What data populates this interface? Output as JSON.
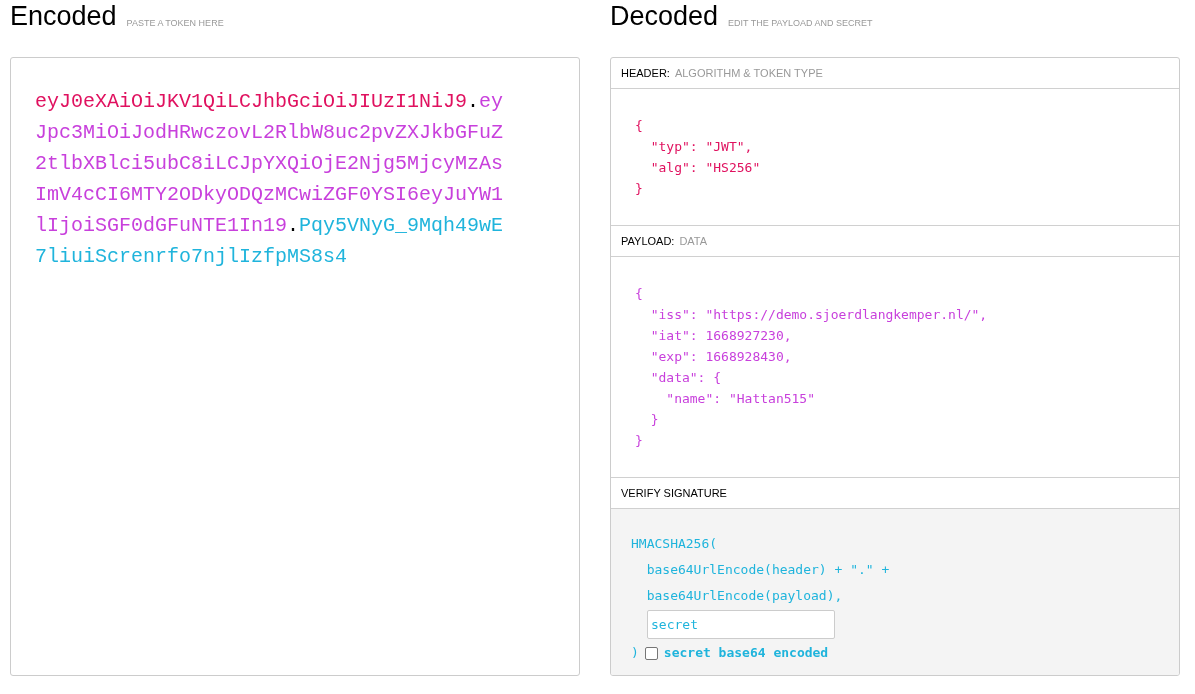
{
  "encoded": {
    "title": "Encoded",
    "hint": "PASTE A TOKEN HERE",
    "parts": [
      {
        "text": "eyJ0eXAiOiJKV1QiLCJhbGciOiJIUzI1NiJ9",
        "color": "#e0115f"
      },
      {
        "text": ".",
        "color": "#000000"
      },
      {
        "text": "eyJpc3MiOiJodHRwczovL2RlbW8uc2pvZXJkbGFuZ2tlbXBlci5ubC8iLCJpYXQiOjE2Njg5MjcyMzAsImV4cCI6MTY2ODkyODQzMCwiZGF0YSI6eyJuYW1lIjoiSGF0dGFuNTE1In19",
        "color": "#c840dc"
      },
      {
        "text": ".",
        "color": "#000000"
      },
      {
        "text": "Pqy5VNyG_9Mqh49wE7liuiScrenrfo7njlIzfpMS8s4",
        "color": "#1fb4dc"
      }
    ]
  },
  "decoded": {
    "title": "Decoded",
    "hint": "EDIT THE PAYLOAD AND SECRET",
    "sections": [
      {
        "kind": "code",
        "label": "HEADER:",
        "sublabel": "ALGORITHM & TOKEN TYPE",
        "color": "#e0115f",
        "lines": [
          "{",
          "  \"typ\": \"JWT\",",
          "  \"alg\": \"HS256\"",
          "}"
        ]
      },
      {
        "kind": "code",
        "label": "PAYLOAD:",
        "sublabel": "DATA",
        "color": "#c840dc",
        "lines": [
          "{",
          "  \"iss\": \"https://demo.sjoerdlangkemper.nl/\",",
          "  \"iat\": 1668927230,",
          "  \"exp\": 1668928430,",
          "  \"data\": {",
          "    \"name\": \"Hattan515\"",
          "  }",
          "}"
        ]
      },
      {
        "kind": "signature",
        "label": "VERIFY SIGNATURE",
        "color": "#1fb4dc",
        "lines": [
          "HMACSHA256(",
          "  base64UrlEncode(header) + \".\" +",
          "  base64UrlEncode(payload),"
        ],
        "secret": "secret",
        "close": ")",
        "checkbox": {
          "label": "secret base64 encoded",
          "checked": false
        }
      }
    ]
  }
}
